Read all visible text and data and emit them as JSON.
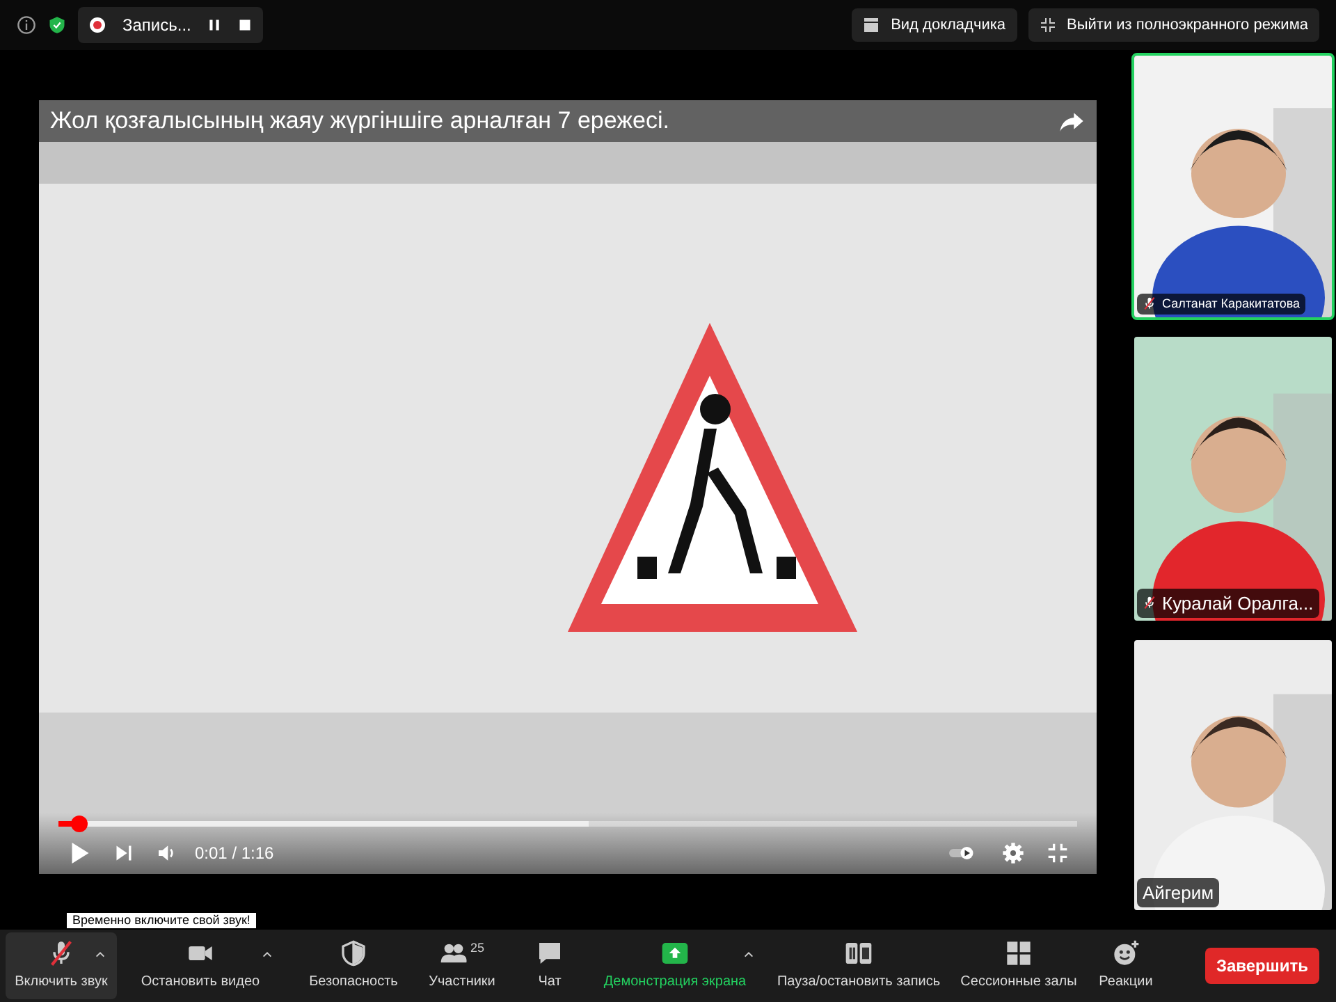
{
  "top_bar": {
    "recording": {
      "label": "Запись..."
    },
    "speaker_view": "Вид докладчика",
    "exit_fullscreen": "Выйти из полноэкранного режима"
  },
  "player": {
    "title": "Жол қозғалысының жаяу жүргіншіге арналған 7 ережесі.",
    "progress": {
      "level": 0.02
    },
    "buffer": {
      "level": 0.52
    },
    "time": "0:01 / 1:16"
  },
  "participants": [
    {
      "name": "Салтанат Каракитатова",
      "muted": true,
      "active": true
    },
    {
      "name": "Куралай Оралга...",
      "muted": true,
      "active": false
    },
    {
      "name": "Айгерим",
      "muted": false,
      "active": false
    }
  ],
  "tooltip": "Временно включите свой звук!",
  "toolbar": {
    "items": [
      {
        "kind": "mic",
        "label": "Включить звук",
        "caret": true,
        "highlight": false
      },
      {
        "kind": "video",
        "label": "Остановить видео",
        "caret": true,
        "highlight": false
      },
      {
        "kind": "security",
        "label": "Безопасность",
        "caret": false,
        "highlight": false
      },
      {
        "kind": "participants",
        "label": "Участники",
        "count": "25",
        "caret": false,
        "highlight": false
      },
      {
        "kind": "chat",
        "label": "Чат",
        "caret": false,
        "highlight": false
      },
      {
        "kind": "share",
        "label": "Демонстрация экрана",
        "caret": true,
        "highlight": true
      },
      {
        "kind": "record",
        "label": "Пауза/остановить запись",
        "caret": false,
        "highlight": false
      },
      {
        "kind": "rooms",
        "label": "Сессионные залы",
        "caret": false,
        "highlight": false
      },
      {
        "kind": "reactions",
        "label": "Реакции",
        "caret": false,
        "highlight": false
      }
    ],
    "end_button": "Завершить"
  }
}
